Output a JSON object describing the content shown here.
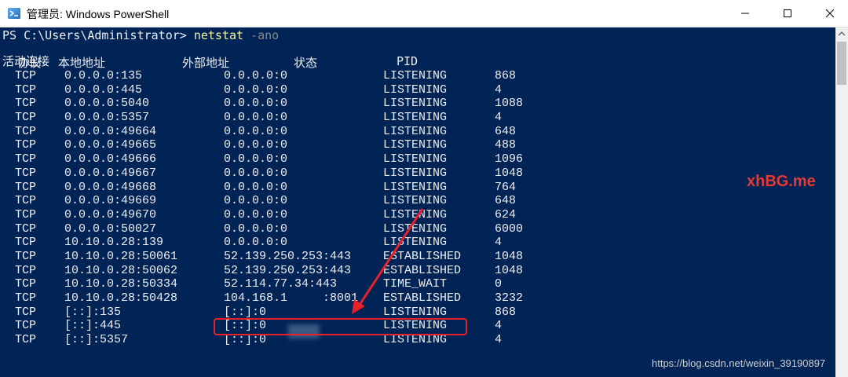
{
  "window": {
    "title": "管理员: Windows PowerShell",
    "accent": "#012456"
  },
  "console": {
    "prompt": "PS C:\\Users\\Administrator> ",
    "command": "netstat",
    "command_arg": " -ano",
    "heading": "活动连接",
    "headers": {
      "proto": "协议",
      "local": "本地地址",
      "foreign": "外部地址",
      "state": "状态",
      "pid": "PID"
    },
    "rows": [
      {
        "proto": "TCP",
        "local": "0.0.0.0:135",
        "foreign": "0.0.0.0:0",
        "state": "LISTENING",
        "pid": "868"
      },
      {
        "proto": "TCP",
        "local": "0.0.0.0:445",
        "foreign": "0.0.0.0:0",
        "state": "LISTENING",
        "pid": "4"
      },
      {
        "proto": "TCP",
        "local": "0.0.0.0:5040",
        "foreign": "0.0.0.0:0",
        "state": "LISTENING",
        "pid": "1088"
      },
      {
        "proto": "TCP",
        "local": "0.0.0.0:5357",
        "foreign": "0.0.0.0:0",
        "state": "LISTENING",
        "pid": "4"
      },
      {
        "proto": "TCP",
        "local": "0.0.0.0:49664",
        "foreign": "0.0.0.0:0",
        "state": "LISTENING",
        "pid": "648"
      },
      {
        "proto": "TCP",
        "local": "0.0.0.0:49665",
        "foreign": "0.0.0.0:0",
        "state": "LISTENING",
        "pid": "488"
      },
      {
        "proto": "TCP",
        "local": "0.0.0.0:49666",
        "foreign": "0.0.0.0:0",
        "state": "LISTENING",
        "pid": "1096"
      },
      {
        "proto": "TCP",
        "local": "0.0.0.0:49667",
        "foreign": "0.0.0.0:0",
        "state": "LISTENING",
        "pid": "1048"
      },
      {
        "proto": "TCP",
        "local": "0.0.0.0:49668",
        "foreign": "0.0.0.0:0",
        "state": "LISTENING",
        "pid": "764"
      },
      {
        "proto": "TCP",
        "local": "0.0.0.0:49669",
        "foreign": "0.0.0.0:0",
        "state": "LISTENING",
        "pid": "648"
      },
      {
        "proto": "TCP",
        "local": "0.0.0.0:49670",
        "foreign": "0.0.0.0:0",
        "state": "LISTENING",
        "pid": "624"
      },
      {
        "proto": "TCP",
        "local": "0.0.0.0:50027",
        "foreign": "0.0.0.0:0",
        "state": "LISTENING",
        "pid": "6000"
      },
      {
        "proto": "TCP",
        "local": "10.10.0.28:139",
        "foreign": "0.0.0.0:0",
        "state": "LISTENING",
        "pid": "4"
      },
      {
        "proto": "TCP",
        "local": "10.10.0.28:50061",
        "foreign": "52.139.250.253:443",
        "state": "ESTABLISHED",
        "pid": "1048"
      },
      {
        "proto": "TCP",
        "local": "10.10.0.28:50062",
        "foreign": "52.139.250.253:443",
        "state": "ESTABLISHED",
        "pid": "1048"
      },
      {
        "proto": "TCP",
        "local": "10.10.0.28:50334",
        "foreign": "52.114.77.34:443",
        "state": "TIME_WAIT",
        "pid": "0"
      },
      {
        "proto": "TCP",
        "local": "10.10.0.28:50428",
        "foreign": "104.168.1     :8001",
        "state": "ESTABLISHED",
        "pid": "3232"
      },
      {
        "proto": "TCP",
        "local": "[::]:135",
        "foreign": "[::]:0",
        "state": "LISTENING",
        "pid": "868"
      },
      {
        "proto": "TCP",
        "local": "[::]:445",
        "foreign": "[::]:0",
        "state": "LISTENING",
        "pid": "4"
      },
      {
        "proto": "TCP",
        "local": "[::]:5357",
        "foreign": "[::]:0",
        "state": "LISTENING",
        "pid": "4"
      }
    ]
  },
  "annotations": {
    "watermark_red": "xhBG.me",
    "watermark_url": "https://blog.csdn.net/weixin_39190897",
    "highlight_color": "#e8202a"
  },
  "icons": {
    "app": "powershell-icon",
    "minimize": "minimize-icon",
    "maximize": "maximize-icon",
    "close": "close-icon",
    "scroll_up": "scroll-up-arrow-icon"
  }
}
